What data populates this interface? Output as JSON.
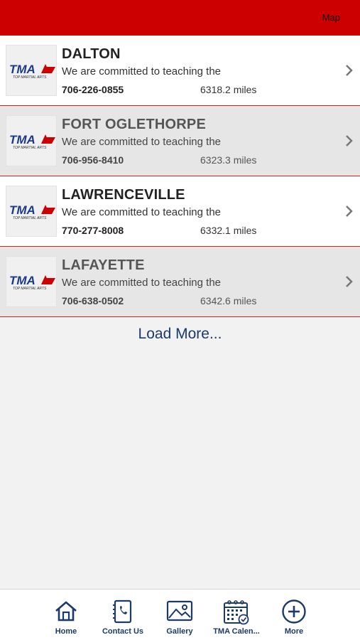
{
  "header": {
    "map_label": "Map"
  },
  "logo": {
    "text": "TMA",
    "tagline": "TOP MARTIAL ARTS"
  },
  "locations": [
    {
      "name": "DALTON",
      "description": "We are committed to teaching the",
      "phone": "706-226-0855",
      "distance": "6318.2 miles"
    },
    {
      "name": "FORT OGLETHORPE",
      "description": "We are committed to teaching the",
      "phone": "706-956-8410",
      "distance": "6323.3 miles"
    },
    {
      "name": "LAWRENCEVILLE",
      "description": "We are committed to teaching the",
      "phone": "770-277-8008",
      "distance": "6332.1 miles"
    },
    {
      "name": "LAFAYETTE",
      "description": "We are committed to teaching the",
      "phone": "706-638-0502",
      "distance": "6342.6 miles"
    }
  ],
  "load_more_label": "Load More...",
  "tabs": [
    {
      "label": "Home",
      "icon": "home-icon"
    },
    {
      "label": "Contact Us",
      "icon": "phone-book-icon"
    },
    {
      "label": "Gallery",
      "icon": "image-icon"
    },
    {
      "label": "TMA Calen...",
      "icon": "calendar-icon"
    },
    {
      "label": "More",
      "icon": "plus-circle-icon"
    }
  ],
  "colors": {
    "header": "#cc0000",
    "accent": "#1a3a6b",
    "divider": "#cc2222"
  }
}
